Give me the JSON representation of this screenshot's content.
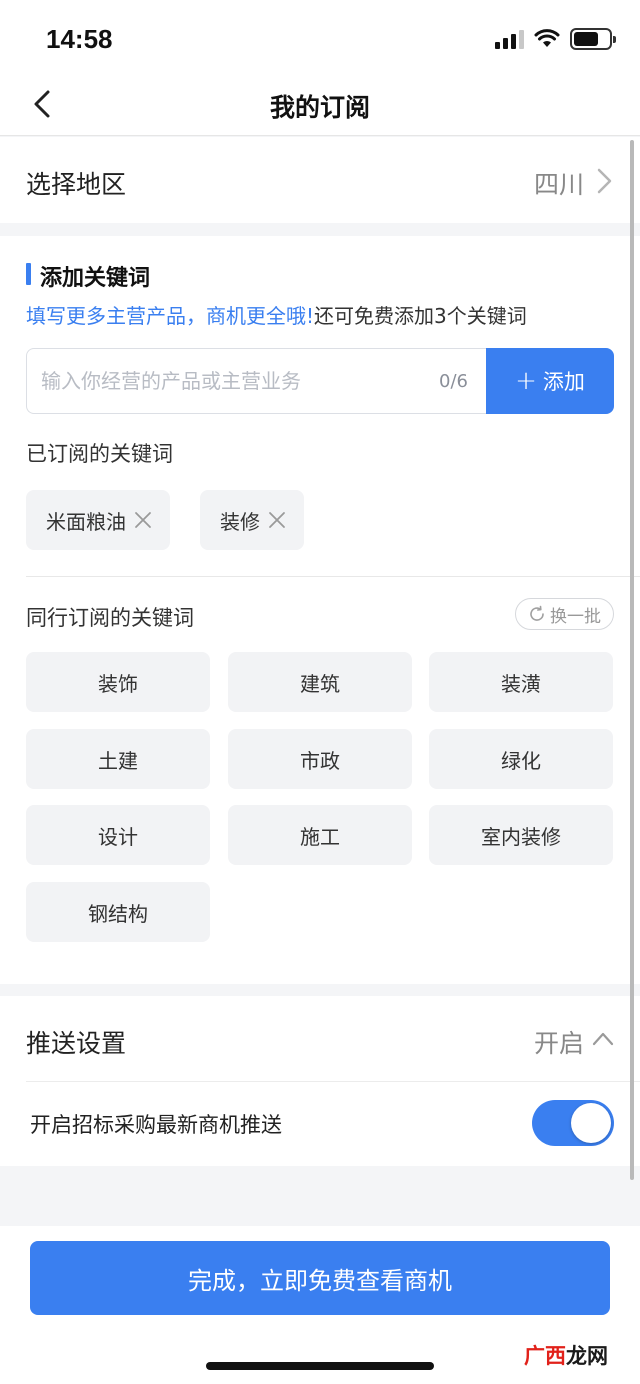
{
  "status_bar": {
    "time": "14:58"
  },
  "nav": {
    "title": "我的订阅"
  },
  "region": {
    "label": "选择地区",
    "value": "四川"
  },
  "keywords": {
    "section_title": "添加关键词",
    "promo_blue": "填写更多主营产品，商机更全哦!",
    "promo_dark": "还可免费添加3个关键词",
    "input_placeholder": "输入你经营的产品或主营业务",
    "input_value": "",
    "counter": "0/6",
    "add_label": "添加",
    "subscribed_label": "已订阅的关键词",
    "subscribed": [
      "米面粮油",
      "装修"
    ],
    "peer_label": "同行订阅的关键词",
    "refresh_label": "换一批",
    "peer": [
      "装饰",
      "建筑",
      "装潢",
      "土建",
      "市政",
      "绿化",
      "设计",
      "施工",
      "室内装修",
      "钢结构"
    ]
  },
  "push": {
    "label": "推送设置",
    "state": "开启",
    "toggle_label": "开启招标采购最新商机推送",
    "toggle_on": true
  },
  "bottom": {
    "done_label": "完成，立即免费查看商机"
  },
  "watermark": {
    "part1": "广西",
    "part2": "龙网"
  },
  "colors": {
    "accent": "#3a7ff0"
  }
}
